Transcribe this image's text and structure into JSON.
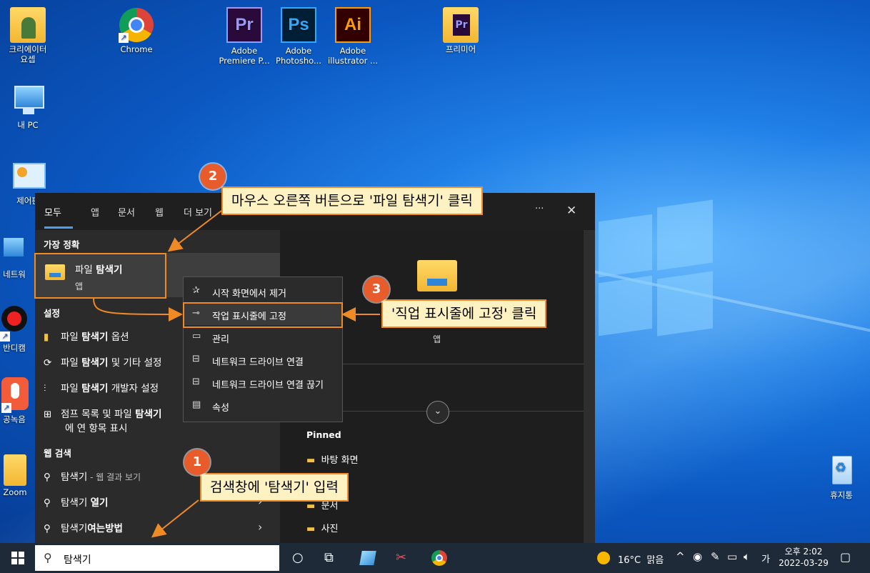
{
  "desktop": {
    "icons": [
      {
        "label": "크리에이터\n요셉",
        "name": "creator-folder-icon"
      },
      {
        "label": "Chrome",
        "name": "chrome-icon"
      },
      {
        "label": "Adobe\nPremiere P...",
        "name": "premiere-icon",
        "glyph": "Pr",
        "color": "#9999ff",
        "bg": "#2a0a3a"
      },
      {
        "label": "Adobe\nPhotosho...",
        "name": "photoshop-icon",
        "glyph": "Ps",
        "color": "#31a8ff",
        "bg": "#001e36"
      },
      {
        "label": "Adobe\nillustrator ...",
        "name": "illustrator-icon",
        "glyph": "Ai",
        "color": "#ff9a00",
        "bg": "#330000"
      },
      {
        "label": "프리미어",
        "name": "premiere-folder-icon"
      },
      {
        "label": "내 PC",
        "name": "this-pc-icon"
      },
      {
        "label": "제어판",
        "name": "control-panel-icon"
      },
      {
        "label": "네트워",
        "name": "network-icon"
      },
      {
        "label": "반디캠",
        "name": "bandicam-icon"
      },
      {
        "label": "공녹음",
        "name": "recorder-icon"
      },
      {
        "label": "Zoom",
        "name": "zoom-folder-icon"
      },
      {
        "label": "휴지통",
        "name": "recycle-bin-icon"
      }
    ]
  },
  "start_menu": {
    "tabs": [
      "모두",
      "앱",
      "문서",
      "웹",
      "더 보기"
    ],
    "more_icon": "···",
    "close_icon": "✕",
    "best_match_header": "가장 정확",
    "best_match": {
      "title_prefix": "파일 ",
      "title_bold": "탐색기",
      "subtitle": "앱"
    },
    "settings_header": "설정",
    "settings_items": [
      {
        "pre": "파일 ",
        "bold": "탐색기",
        "post": " 옵션",
        "icon": "folder-options-icon"
      },
      {
        "pre": "파일 ",
        "bold": "탐색기",
        "post": " 및 기타 설정",
        "icon": "sync-icon"
      },
      {
        "pre": "파일 ",
        "bold": "탐색기",
        "post": " 개발자 설정",
        "icon": "developer-icon"
      },
      {
        "pre": "점프 목록 및 파일 ",
        "bold": "탐색기",
        "post": "",
        "line2": "에 연 항목 표시",
        "icon": "jumplist-icon"
      }
    ],
    "web_header": "웹 검색",
    "web_items": [
      {
        "pre": "탐색기",
        "bold": "",
        "sub": " - 웹 결과 보기"
      },
      {
        "pre": "탐색기 ",
        "bold": "열기",
        "sub": ""
      },
      {
        "pre": "탐색기",
        "bold": "여는방법",
        "sub": ""
      }
    ],
    "right_panel": {
      "app_label": "앱",
      "pinned_header": "Pinned",
      "pinned_items": [
        "바탕 화면",
        "문서",
        "사진"
      ]
    }
  },
  "context_menu": {
    "items": [
      {
        "label": "시작 화면에서 제거",
        "icon": "unpin-icon",
        "glyph": "✰"
      },
      {
        "label": "작업 표시줄에 고정",
        "icon": "pin-taskbar-icon",
        "glyph": "⊸"
      },
      {
        "label": "관리",
        "icon": "manage-icon",
        "glyph": "▭"
      },
      {
        "label": "네트워크 드라이브 연결",
        "icon": "map-drive-icon",
        "glyph": "⊟"
      },
      {
        "label": "네트워크 드라이브 연결 끊기",
        "icon": "disconnect-drive-icon",
        "glyph": "⊟"
      },
      {
        "label": "속성",
        "icon": "properties-icon",
        "glyph": "▤"
      }
    ]
  },
  "annotations": {
    "step1": {
      "num": "1",
      "text": "검색창에 '탐색기' 입력"
    },
    "step2": {
      "num": "2",
      "text": "마우스 오른쪽 버튼으로 '파일 탐색기' 클릭"
    },
    "step3": {
      "num": "3",
      "text": "'직업 표시줄에 고정' 클릭"
    }
  },
  "taskbar": {
    "search_value": "탐색기",
    "weather": "16°C  맑음",
    "ime": "가",
    "time": "오후 2:02",
    "date": "2022-03-29"
  }
}
